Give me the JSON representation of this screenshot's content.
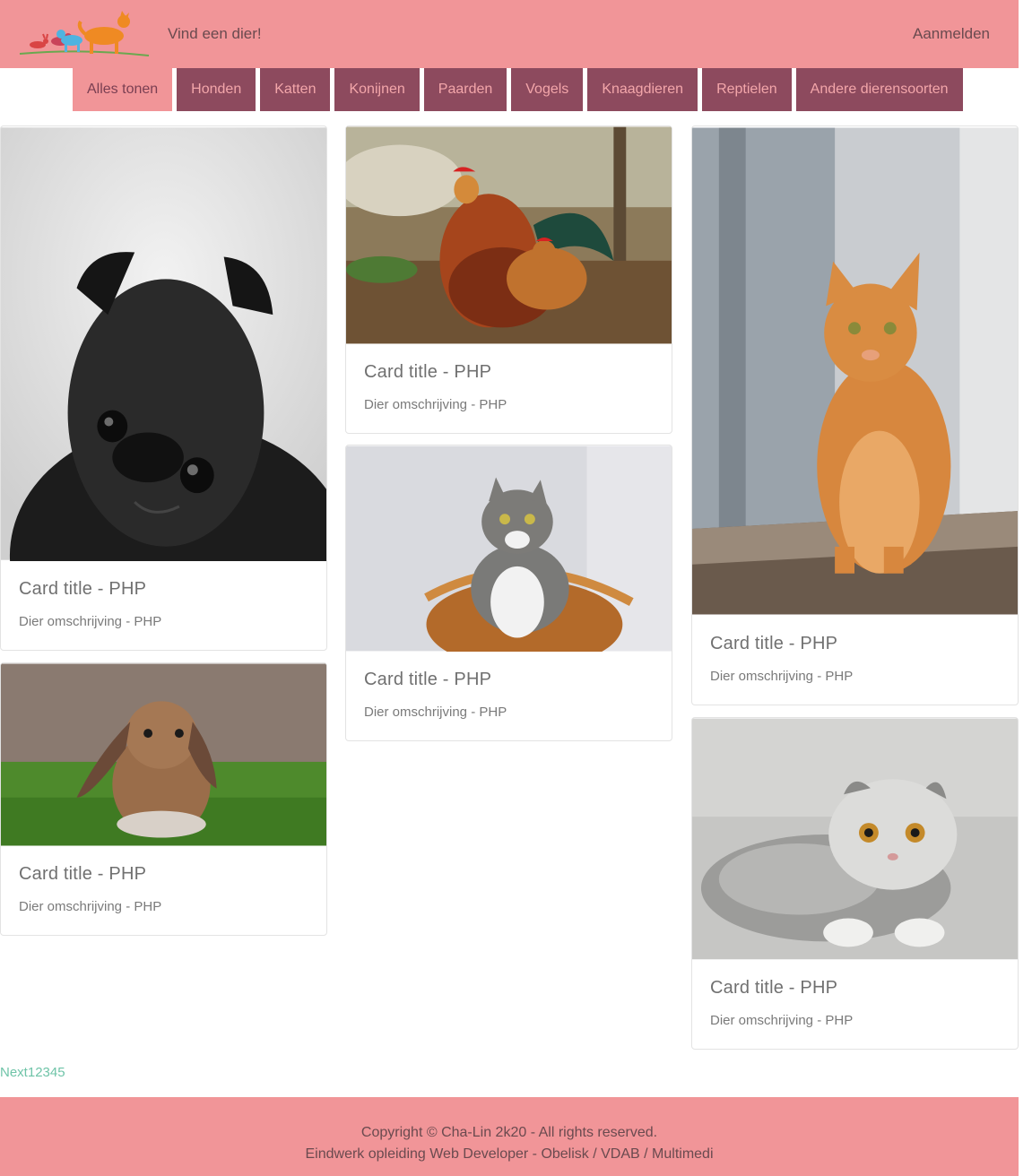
{
  "header": {
    "tagline": "Vind een dier!",
    "login_label": "Aanmelden"
  },
  "filters": [
    {
      "label": "Alles tonen",
      "active": true
    },
    {
      "label": "Honden",
      "active": false
    },
    {
      "label": "Katten",
      "active": false
    },
    {
      "label": "Konijnen",
      "active": false
    },
    {
      "label": "Paarden",
      "active": false
    },
    {
      "label": "Vogels",
      "active": false
    },
    {
      "label": "Knaagdieren",
      "active": false
    },
    {
      "label": "Reptielen",
      "active": false
    },
    {
      "label": "Andere dierensoorten",
      "active": false
    }
  ],
  "cards": [
    {
      "image": "black-pug-photo",
      "title": "Card title - PHP",
      "description": "Dier omschrijving - PHP"
    },
    {
      "image": "rabbit-photo",
      "title": "Card title - PHP",
      "description": "Dier omschrijving - PHP"
    },
    {
      "image": "rooster-photo",
      "title": "Card title - PHP",
      "description": "Dier omschrijving - PHP"
    },
    {
      "image": "grey-cat-basket-photo",
      "title": "Card title - PHP",
      "description": "Dier omschrijving - PHP"
    },
    {
      "image": "orange-tabby-cat-photo",
      "title": "Card title - PHP",
      "description": "Dier omschrijving - PHP"
    },
    {
      "image": "scottish-fold-kitten-photo",
      "title": "Card title - PHP",
      "description": "Dier omschrijving - PHP"
    }
  ],
  "pagination": {
    "next_label": "Next",
    "pages": [
      "1",
      "2",
      "3",
      "4",
      "5"
    ]
  },
  "footer": {
    "line1": "Copyright © Cha-Lin 2k20 - All rights reserved.",
    "line2": "Eindwerk opleiding Web Developer - Obelisk / VDAB / Multimedi"
  },
  "colors": {
    "header_bg": "#f19598",
    "filter_bg": "#8d4a5e",
    "filter_text": "#f3a6aa",
    "pager_link": "#6fc4a8"
  }
}
